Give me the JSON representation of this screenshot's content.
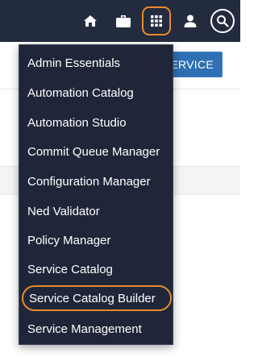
{
  "topbar": {
    "icons": [
      "home-icon",
      "briefcase-icon",
      "apps-grid-icon",
      "user-icon",
      "search-icon"
    ],
    "highlight_color": "#e8892c"
  },
  "page": {
    "service_button_label": "ERVICE"
  },
  "app_menu": {
    "items": [
      {
        "label": "Admin Essentials"
      },
      {
        "label": "Automation Catalog"
      },
      {
        "label": "Automation Studio"
      },
      {
        "label": "Commit Queue Manager"
      },
      {
        "label": "Configuration Manager"
      },
      {
        "label": "Ned Validator"
      },
      {
        "label": "Policy Manager"
      },
      {
        "label": "Service Catalog"
      },
      {
        "label": "Service Catalog Builder",
        "highlighted": true
      },
      {
        "label": "Service Management"
      }
    ]
  },
  "colors": {
    "topbar_bg": "#232b3e",
    "menu_bg": "#1f2639",
    "accent_blue": "#2f6fb3",
    "highlight_orange": "#e8892c"
  }
}
